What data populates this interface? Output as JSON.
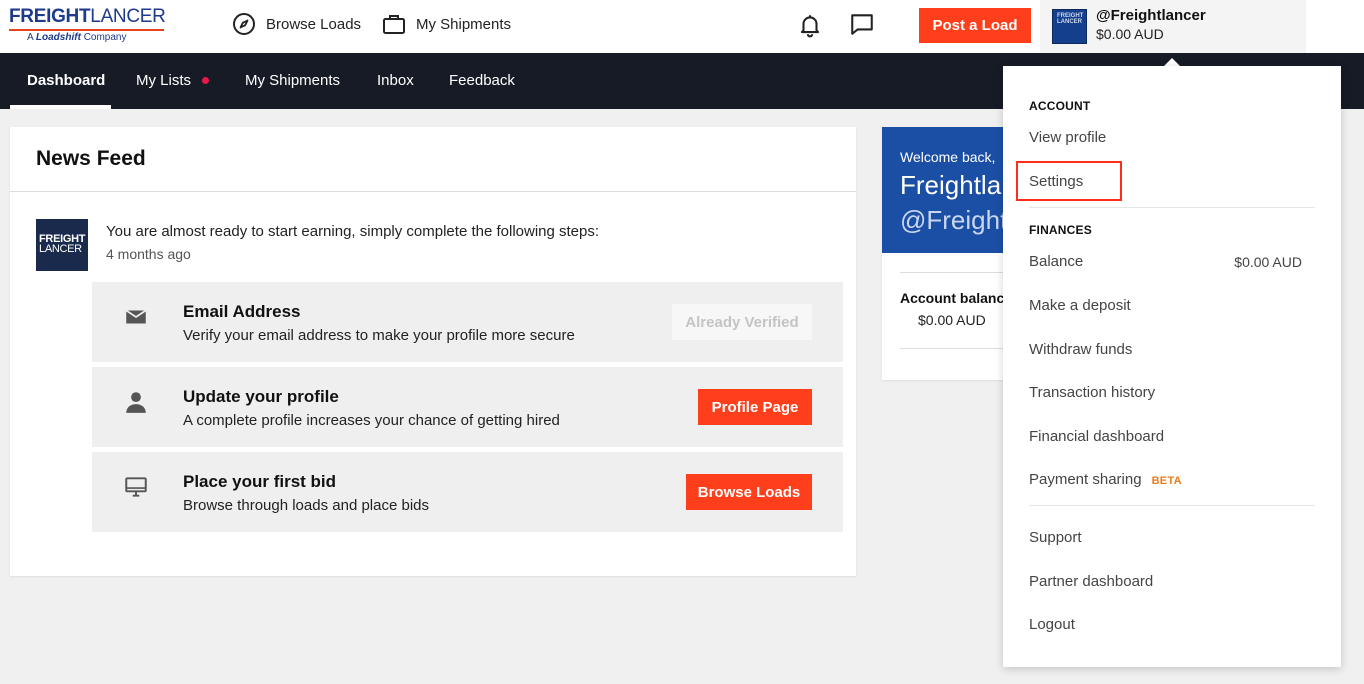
{
  "header": {
    "logo": {
      "part1": "FREIGHT",
      "part2": "LANCER",
      "sub_a": "A",
      "sub_brand": "Loadshift",
      "sub_company": "Company"
    },
    "browse_loads": "Browse Loads",
    "my_shipments": "My Shipments",
    "post_load": "Post a Load",
    "user": {
      "handle": "@Freightlancer",
      "balance": "$0.00 AUD",
      "avatar_text": "FREIGHT LANCER"
    }
  },
  "nav": {
    "items": [
      "Dashboard",
      "My Lists",
      "My Shipments",
      "Inbox",
      "Feedback"
    ],
    "active_index": 0
  },
  "news": {
    "title": "News Feed",
    "logo_line1": "FREIGHT",
    "logo_line2": "LANCER",
    "message": "You are almost ready to start earning, simply complete the following steps:",
    "time": "4 months ago",
    "steps": [
      {
        "icon": "envelope-icon",
        "title": "Email Address",
        "desc": "Verify your email address to make your profile more secure",
        "button": "Already Verified",
        "disabled": true
      },
      {
        "icon": "person-icon",
        "title": "Update your profile",
        "desc": "A complete profile increases your chance of getting hired",
        "button": "Profile Page",
        "disabled": false
      },
      {
        "icon": "monitor-icon",
        "title": "Place your first bid",
        "desc": "Browse through loads and place bids",
        "button": "Browse Loads",
        "disabled": false
      }
    ]
  },
  "welcome": {
    "greeting": "Welcome back,",
    "name": "Freightla",
    "handle": "@Freight",
    "account_label": "Account balanc",
    "account_value": "$0.00 AUD"
  },
  "dropdown": {
    "account_heading": "ACCOUNT",
    "view_profile": "View profile",
    "settings": "Settings",
    "finances_heading": "FINANCES",
    "balance": "Balance",
    "balance_value": "$0.00 AUD",
    "make_deposit": "Make a deposit",
    "withdraw": "Withdraw funds",
    "transactions": "Transaction history",
    "financial_dashboard": "Financial dashboard",
    "payment_sharing": "Payment sharing",
    "beta": "BETA",
    "support": "Support",
    "partner_dashboard": "Partner dashboard",
    "logout": "Logout"
  },
  "colors": {
    "accent": "#ff3f1c",
    "nav_bg": "#161b26",
    "brand_blue": "#1b4fa6",
    "highlight": "#ff2d1a",
    "beta": "#e97d1e"
  }
}
